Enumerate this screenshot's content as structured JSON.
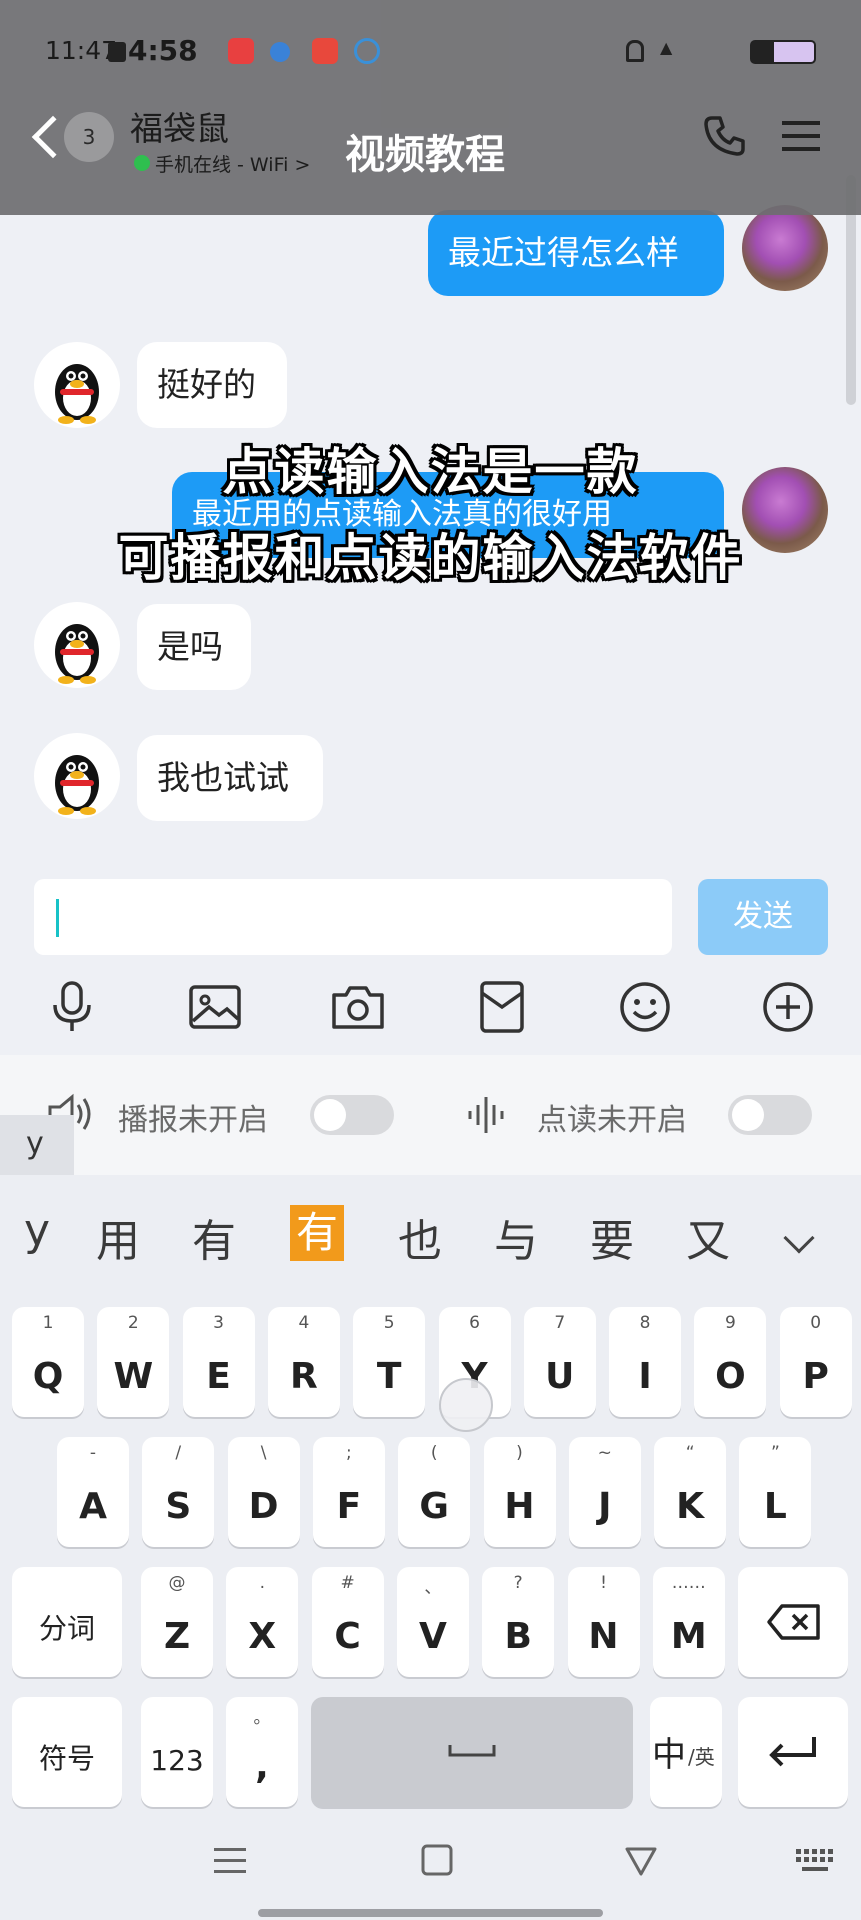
{
  "status_bar": {
    "time": "11:47",
    "clock_app_time": "4:58"
  },
  "header": {
    "unread_count": "3",
    "contact_name": "福袋鼠",
    "contact_status": "手机在线 - WiFi",
    "title": "视频教程",
    "icons": [
      "back-arrow-icon",
      "phone-icon",
      "menu-icon"
    ]
  },
  "messages": [
    {
      "from": "me",
      "text": "最近过得怎么样"
    },
    {
      "from": "them",
      "text": "挺好的"
    },
    {
      "from": "me",
      "text": "最近用的点读输入法真的很好用"
    },
    {
      "from": "them",
      "text": "是吗"
    },
    {
      "from": "them",
      "text": "我也试试"
    }
  ],
  "caption": {
    "line1": "点读输入法是一款",
    "line2": "可播报和点读的输入法软件"
  },
  "input": {
    "value": "",
    "send_label": "发送"
  },
  "toolbar": [
    "microphone-icon",
    "image-icon",
    "camera-icon",
    "sticker-icon",
    "emoji-icon",
    "add-icon"
  ],
  "toggles": {
    "broadcast_label": "播报未开启",
    "read_label": "点读未开启",
    "broadcast_on": false,
    "read_on": false
  },
  "composing": "y",
  "candidates": [
    "y",
    "用",
    "有",
    "有",
    "也",
    "与",
    "要",
    "又"
  ],
  "selected_candidate_index": 3,
  "keyboard": {
    "row1": [
      {
        "k": "Q",
        "s": "1"
      },
      {
        "k": "W",
        "s": "2"
      },
      {
        "k": "E",
        "s": "3"
      },
      {
        "k": "R",
        "s": "4"
      },
      {
        "k": "T",
        "s": "5"
      },
      {
        "k": "Y",
        "s": "6"
      },
      {
        "k": "U",
        "s": "7"
      },
      {
        "k": "I",
        "s": "8"
      },
      {
        "k": "O",
        "s": "9"
      },
      {
        "k": "P",
        "s": "0"
      }
    ],
    "row2": [
      {
        "k": "A",
        "s": "-"
      },
      {
        "k": "S",
        "s": "/"
      },
      {
        "k": "D",
        "s": "\\"
      },
      {
        "k": "F",
        "s": ";"
      },
      {
        "k": "G",
        "s": "("
      },
      {
        "k": "H",
        "s": ")"
      },
      {
        "k": "J",
        "s": "~"
      },
      {
        "k": "K",
        "s": "“"
      },
      {
        "k": "L",
        "s": "”"
      }
    ],
    "row3": [
      {
        "k": "Z",
        "s": "@"
      },
      {
        "k": "X",
        "s": "."
      },
      {
        "k": "C",
        "s": "#"
      },
      {
        "k": "V",
        "s": "、"
      },
      {
        "k": "B",
        "s": "?"
      },
      {
        "k": "N",
        "s": "!"
      },
      {
        "k": "M",
        "s": "……"
      }
    ],
    "segment_label": "分词",
    "symbol_label": "符号",
    "number_label": "123",
    "comma_label": ",",
    "comma_sub": "。",
    "lang_label": "中",
    "lang_sub": "/英"
  }
}
